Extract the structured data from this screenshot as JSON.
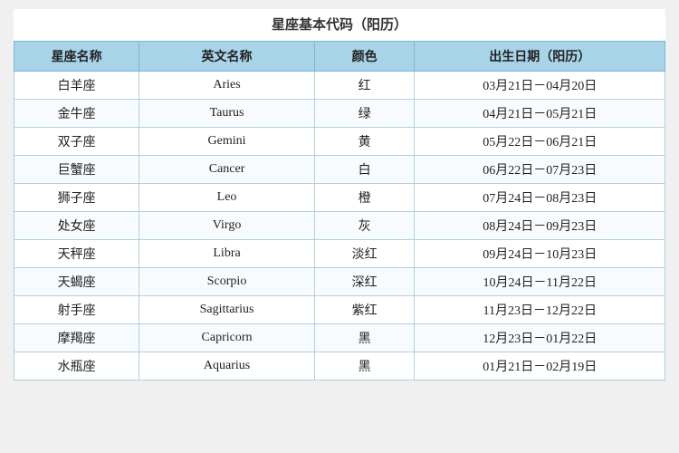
{
  "title": "星座基本代码（阳历）",
  "headers": {
    "chinese_name": "星座名称",
    "english_name": "英文名称",
    "color": "颜色",
    "birth_date": "出生日期（阳历）"
  },
  "rows": [
    {
      "chinese": "白羊座",
      "english": "Aries",
      "color": "红",
      "date": "03月21日－04月20日"
    },
    {
      "chinese": "金牛座",
      "english": "Taurus",
      "color": "绿",
      "date": "04月21日－05月21日"
    },
    {
      "chinese": "双子座",
      "english": "Gemini",
      "color": "黄",
      "date": "05月22日－06月21日"
    },
    {
      "chinese": "巨蟹座",
      "english": "Cancer",
      "color": "白",
      "date": "06月22日－07月23日"
    },
    {
      "chinese": "狮子座",
      "english": "Leo",
      "color": "橙",
      "date": "07月24日－08月23日"
    },
    {
      "chinese": "处女座",
      "english": "Virgo",
      "color": "灰",
      "date": "08月24日－09月23日"
    },
    {
      "chinese": "天秤座",
      "english": "Libra",
      "color": "淡红",
      "date": "09月24日－10月23日"
    },
    {
      "chinese": "天蝎座",
      "english": "Scorpio",
      "color": "深红",
      "date": "10月24日－11月22日"
    },
    {
      "chinese": "射手座",
      "english": "Sagittarius",
      "color": "紫红",
      "date": "11月23日－12月22日"
    },
    {
      "chinese": "摩羯座",
      "english": "Capricorn",
      "color": "黑",
      "date": "12月23日－01月22日"
    },
    {
      "chinese": "水瓶座",
      "english": "Aquarius",
      "color": "黑",
      "date": "01月21日－02月19日"
    }
  ]
}
